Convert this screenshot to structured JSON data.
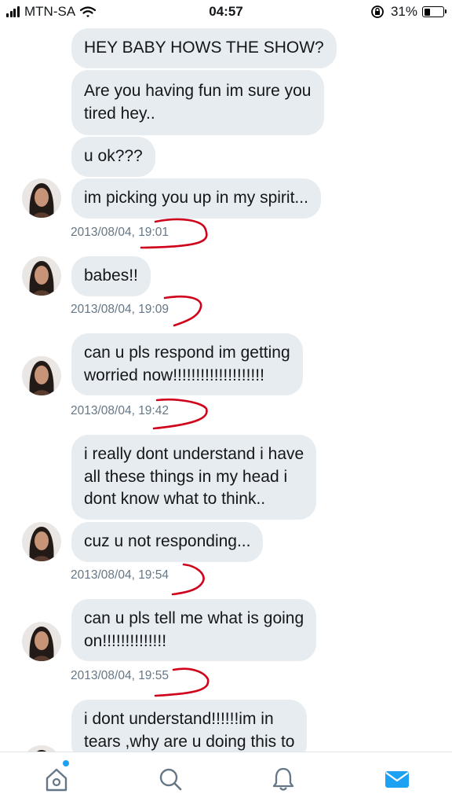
{
  "status_bar": {
    "carrier": "MTN-SA",
    "time": "04:57",
    "battery_percent": "31%",
    "battery_level": 0.31
  },
  "messages": [
    {
      "text": "HEY BABY HOWS THE SHOW?"
    },
    {
      "text": "Are you having fun im sure you\ntired hey.."
    },
    {
      "text": "u ok???"
    },
    {
      "text": "im picking you up in my spirit..."
    },
    {
      "text": "babes!!"
    },
    {
      "text": "can u pls respond im getting\nworried now!!!!!!!!!!!!!!!!!!!!"
    },
    {
      "text": "i really dont understand i have\nall these things in my head i\ndont know what to think.."
    },
    {
      "text": "cuz u not responding..."
    },
    {
      "text": "can u pls tell me what is going\non!!!!!!!!!!!!!!"
    },
    {
      "text": "i dont understand!!!!!!im in\ntears ,why are u doing this to"
    }
  ],
  "timestamps": [
    "2013/08/04, 19:01",
    "2013/08/04, 19:09",
    "2013/08/04, 19:42",
    "2013/08/04, 19:54",
    "2013/08/04, 19:55"
  ],
  "tabs": [
    {
      "icon": "home-icon",
      "notification": true
    },
    {
      "icon": "search-icon"
    },
    {
      "icon": "bell-icon"
    },
    {
      "icon": "mail-icon",
      "active": true
    }
  ],
  "colors": {
    "bubble": "#e6ecf0",
    "timestamp": "#657786",
    "accent": "#1da1f2",
    "annotation": "#d0021b"
  }
}
